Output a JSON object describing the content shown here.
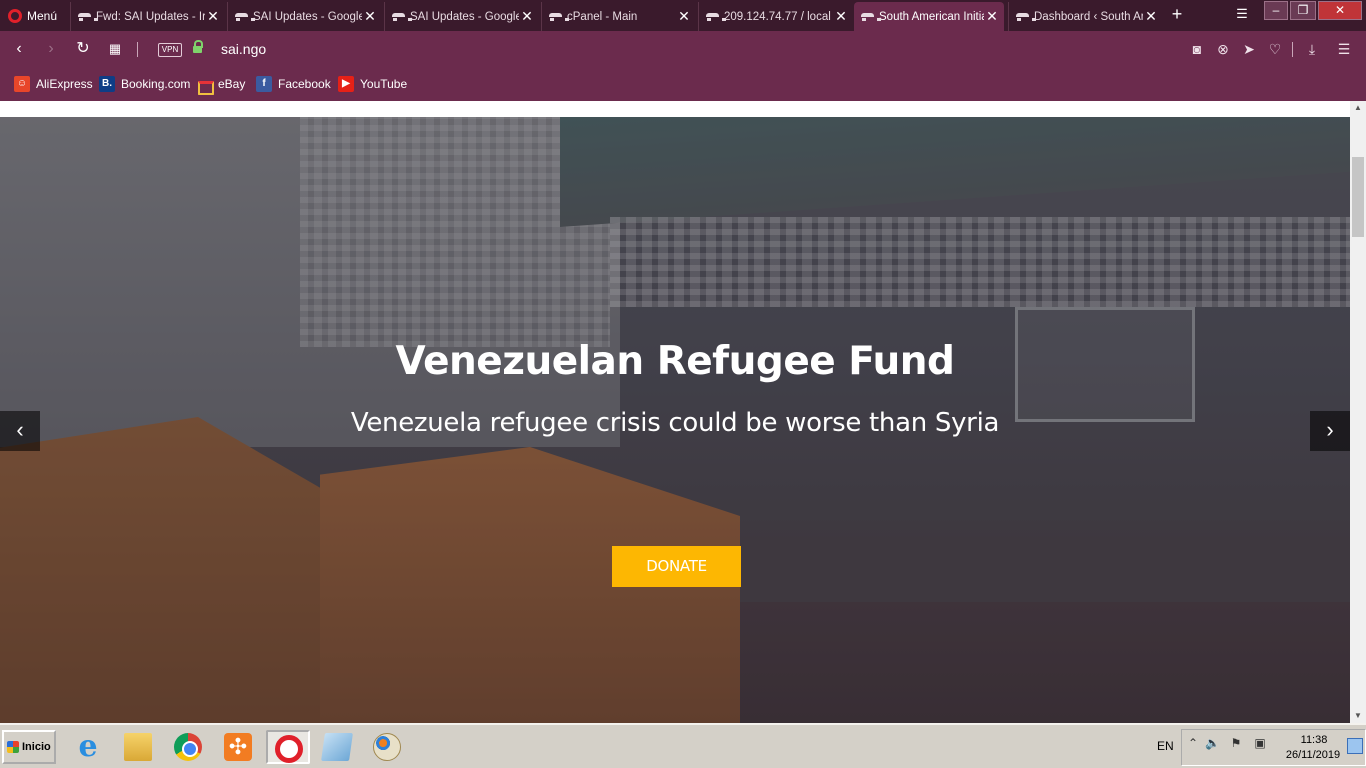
{
  "browser": {
    "menu_label": "Menú",
    "tabs": [
      {
        "title": "Fwd: SAI Updates - Ir",
        "active": false
      },
      {
        "title": "SAI Updates - Google",
        "active": false
      },
      {
        "title": "SAI Updates - Google",
        "active": false
      },
      {
        "title": "cPanel - Main",
        "active": false
      },
      {
        "title": "209.124.74.77 / local",
        "active": false
      },
      {
        "title": "South American Initia",
        "active": true
      },
      {
        "title": "Dashboard ‹ South Ar",
        "active": false
      }
    ],
    "new_tab_label": "+",
    "address": {
      "vpn_label": "VPN",
      "url": "sai.ngo"
    },
    "bookmarks": [
      {
        "label": "AliExpress",
        "icon": "aliexpress-icon"
      },
      {
        "label": "Booking.com",
        "icon": "booking-icon"
      },
      {
        "label": "eBay",
        "icon": "ebay-icon"
      },
      {
        "label": "Facebook",
        "icon": "facebook-icon"
      },
      {
        "label": "YouTube",
        "icon": "youtube-icon"
      }
    ],
    "colors": {
      "chrome": "#6b2b4d",
      "tabstrip": "#3a1a2c"
    }
  },
  "hero": {
    "title": "Venezuelan Refugee Fund",
    "subtitle": "Venezuela refugee crisis could be worse than Syria",
    "donate_label": "DONATE",
    "prev_icon": "‹",
    "next_icon": "›",
    "accent": "#fdb702"
  },
  "taskbar": {
    "start_label": "Inicio",
    "apps": [
      "internet-explorer-icon",
      "file-explorer-icon",
      "chrome-icon",
      "xampp-icon",
      "opera-icon",
      "notepad-icon",
      "paint-icon"
    ],
    "language": "EN",
    "time": "11:38",
    "date": "26/11/2019"
  }
}
